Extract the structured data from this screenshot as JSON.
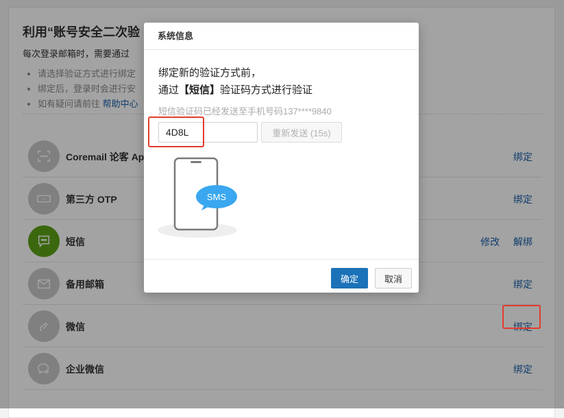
{
  "page": {
    "title": "利用“账号安全二次验",
    "subtitle": "每次登录邮箱时，需要通过",
    "tips": [
      {
        "text": "请选择验证方式进行绑定"
      },
      {
        "text": "绑定后，登录时会进行安"
      },
      {
        "text": "如有疑问请前往 ",
        "link": "帮助中心"
      }
    ]
  },
  "methods": [
    {
      "label": "Coremail 论客 Ap",
      "icon": "scan-icon",
      "actions": [
        "绑定"
      ]
    },
    {
      "label": "第三方 OTP",
      "icon": "otp-icon",
      "actions": [
        "绑定"
      ]
    },
    {
      "label": "短信",
      "icon": "sms-icon",
      "actions": [
        "修改",
        "解绑"
      ],
      "active": true
    },
    {
      "label": "备用邮箱",
      "icon": "mail-icon",
      "actions": [
        "绑定"
      ]
    },
    {
      "label": "微信",
      "icon": "wechat-icon",
      "actions": [
        "绑定"
      ]
    },
    {
      "label": "企业微信",
      "icon": "wecom-icon",
      "actions": [
        "绑定"
      ]
    }
  ],
  "dialog": {
    "title": "系统信息",
    "message_line1": "绑定新的验证方式前，",
    "message_line2_prefix": "通过",
    "message_line2_bold": "【短信】",
    "message_line2_suffix": "验证码方式进行验证",
    "hint": "短信验证码已经发送至手机号码137****9840",
    "code_value": "4D8L",
    "resend_label": "重新发送 (15s)",
    "illustration_badge": "SMS",
    "ok_label": "确定",
    "cancel_label": "取消"
  },
  "colors": {
    "link": "#1a5fa8",
    "primary_button": "#1b72b8",
    "active_icon": "#5da317",
    "highlight": "#e33b2e",
    "sms_bubble": "#3aa7f0"
  }
}
